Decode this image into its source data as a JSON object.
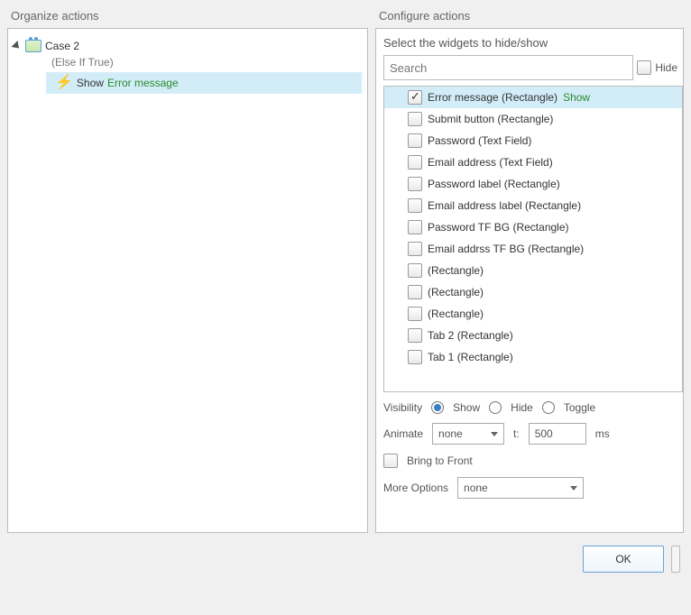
{
  "panels": {
    "organize_title": "Organize actions",
    "configure_title": "Configure actions"
  },
  "tree": {
    "case_label": "Case 2",
    "case_condition": "(Else If True)",
    "action_prefix": "Show",
    "action_target": "Error message"
  },
  "configure": {
    "section_label": "Select the widgets to hide/show",
    "search_placeholder": "Search",
    "hide_label": "Hide",
    "widgets": [
      {
        "label": "Error message (Rectangle)",
        "checked": true,
        "state": "Show"
      },
      {
        "label": "Submit button (Rectangle)",
        "checked": false
      },
      {
        "label": "Password (Text Field)",
        "checked": false
      },
      {
        "label": "Email address (Text Field)",
        "checked": false
      },
      {
        "label": "Password label (Rectangle)",
        "checked": false
      },
      {
        "label": "Email address label (Rectangle)",
        "checked": false
      },
      {
        "label": "Password TF BG (Rectangle)",
        "checked": false
      },
      {
        "label": "Email addrss TF BG (Rectangle)",
        "checked": false
      },
      {
        "label": "(Rectangle)",
        "checked": false
      },
      {
        "label": "(Rectangle)",
        "checked": false
      },
      {
        "label": "(Rectangle)",
        "checked": false
      },
      {
        "label": "Tab 2 (Rectangle)",
        "checked": false
      },
      {
        "label": "Tab 1 (Rectangle)",
        "checked": false
      }
    ],
    "visibility_label": "Visibility",
    "visibility_options": {
      "show": "Show",
      "hide": "Hide",
      "toggle": "Toggle"
    },
    "visibility_selected": "show",
    "animate_label": "Animate",
    "animate_value": "none",
    "time_label": "t:",
    "time_value": "500",
    "time_unit": "ms",
    "bring_front_label": "Bring to Front",
    "more_options_label": "More Options",
    "more_options_value": "none"
  },
  "footer": {
    "ok_label": "OK"
  }
}
